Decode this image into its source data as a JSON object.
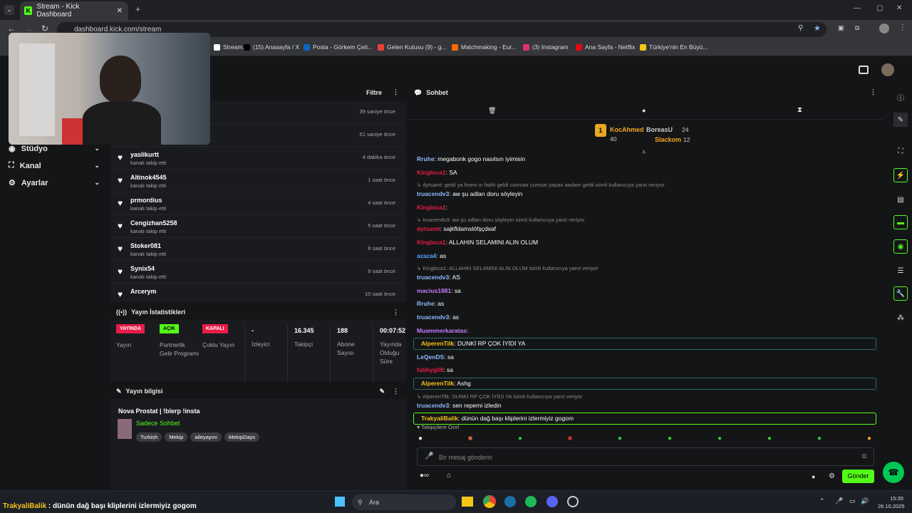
{
  "browser": {
    "tab_title": "Stream - Kick Dashboard",
    "url": "dashboard.kick.com/stream",
    "bookmarks": [
      {
        "label": "Stream...",
        "color": "#ffffff"
      },
      {
        "label": "(15) Anasayfa / X",
        "color": "#000000"
      },
      {
        "label": "Posta - Görkem Çeti...",
        "color": "#0a66c2"
      },
      {
        "label": "Gelen Kutusu (9) - g...",
        "color": "#ea4335"
      },
      {
        "label": "Matchmaking - Eur...",
        "color": "#ff6a00"
      },
      {
        "label": "(3) Instagram",
        "color": "#e1306c"
      },
      {
        "label": "Ana Sayfa - Netflix",
        "color": "#e50914"
      },
      {
        "label": "Türkiye'nin En Büyü...",
        "color": "#f5c518"
      }
    ]
  },
  "sidebar": {
    "items": [
      {
        "label": "Stüdyo",
        "icon": "studio-icon"
      },
      {
        "label": "Kanal",
        "icon": "channel-icon"
      },
      {
        "label": "Ayarlar",
        "icon": "gear-icon"
      }
    ]
  },
  "activity": {
    "filter_label": "Filtre",
    "rows": [
      {
        "name": "",
        "sub": "",
        "time": "39 saniye önce"
      },
      {
        "name": "",
        "sub": "",
        "time": "51 saniye önce"
      },
      {
        "name": "yaslikurtt",
        "sub": "kanalı takip etti",
        "time": "4 dakika önce"
      },
      {
        "name": "Altinok4545",
        "sub": "kanalı takip etti",
        "time": "1 saat önce"
      },
      {
        "name": "prmordius",
        "sub": "kanalı takip etti",
        "time": "4 saat önce"
      },
      {
        "name": "Cengizhan5258",
        "sub": "kanalı takip etti",
        "time": "5 saat önce"
      },
      {
        "name": "Stoker081",
        "sub": "kanalı takip etti",
        "time": "8 saat önce"
      },
      {
        "name": "Synix54",
        "sub": "kanalı takip etti",
        "time": "9 saat önce"
      },
      {
        "name": "Arcerym",
        "sub": "",
        "time": "10 saat önce"
      }
    ]
  },
  "stats": {
    "title": "Yayın İstatistikleri",
    "cols": [
      {
        "badge": "YAYINDA",
        "badge_color": "#e91b47",
        "badge_text_color": "#ffffff",
        "label": "Yayın"
      },
      {
        "badge": "AÇIK",
        "badge_color": "#53fc18",
        "badge_text_color": "#000000",
        "label": "Partnerlik Gelir Programı"
      },
      {
        "badge": "KAPALI",
        "badge_color": "#e91b47",
        "badge_text_color": "#ffffff",
        "label": "Çoklu Yayın"
      },
      {
        "value": "-",
        "label": "İzleyici"
      },
      {
        "value": "16.345",
        "label": "Takipçi"
      },
      {
        "value": "188",
        "label": "Abone Sayısı"
      },
      {
        "value": "00:07:52",
        "label": "Yayında Olduğu Süre"
      }
    ]
  },
  "info": {
    "title": "Yayın bilgisi",
    "stream_title": "Nova Prostat | !blerp !insta",
    "category": "Sadece Sohbet",
    "tags": [
      "Turkish",
      "Mekip",
      "aileyayını",
      "MekipDays"
    ]
  },
  "chat": {
    "title": "Sohbet",
    "leaderboard": {
      "first": {
        "name": "KocAhmed",
        "count": "40",
        "rank": "1"
      },
      "second": {
        "name": "BoreasU",
        "count": "24"
      },
      "third": {
        "name": "Slackom",
        "count": "12"
      }
    },
    "messages": [
      {
        "type": "msg",
        "user": "Rruhe",
        "color": "#8fb8ff",
        "text": ": megabonk gogo nasılsın iyimisin"
      },
      {
        "type": "msg",
        "user": "Kingloca1",
        "color": "#e91b47",
        "text": ": SA"
      },
      {
        "type": "reply",
        "text": "dytsamt: geldi ya fivem in fatihi geldi comsatı cumsat yapan aadam geldi isimli kullanıcıya yanıt veriyor"
      },
      {
        "type": "msg",
        "user": "truacendv3",
        "color": "#8fb8ff",
        "text": ": aw şu adları doru söyleyin"
      },
      {
        "type": "msg",
        "user": "Kingloca1",
        "color": "#e91b47",
        "text": ":"
      },
      {
        "type": "reply",
        "text": "truacendv3: aw şu adları doru söyleyin isimli kullanıcıya yanıt veriyor"
      },
      {
        "type": "msg",
        "user": "dytsamt",
        "color": "#e91b47",
        "text": ": sajkfldamslöfşçdsaf"
      },
      {
        "type": "msg",
        "user": "Kingloca1",
        "color": "#e91b47",
        "text": ": ALLAHIN SELAMINI ALIN OLUM"
      },
      {
        "type": "msg",
        "user": "azaza4",
        "color": "#4fa3ff",
        "text": ": as"
      },
      {
        "type": "reply",
        "text": "Kingloca1: ALLAHIN SELAMINI ALIN OLUM isimli kullanıcıya yanıt veriyor"
      },
      {
        "type": "msg",
        "user": "truacendv3",
        "color": "#8fb8ff",
        "text": ": AS"
      },
      {
        "type": "msg",
        "user": "macius1881",
        "color": "#c77dff",
        "text": ": sa"
      },
      {
        "type": "msg",
        "user": "Rruhe",
        "color": "#8fb8ff",
        "text": ": as"
      },
      {
        "type": "msg",
        "user": "truacendv3",
        "color": "#8fb8ff",
        "text": ": as"
      },
      {
        "type": "msg",
        "user": "Muammerkaratas",
        "color": "#c77dff",
        "text": ":"
      },
      {
        "type": "msg",
        "user": "AlperenTilk",
        "color": "#f5c518",
        "text": ": DUNKİ RP ÇOK İYİDİ YA",
        "hl": true
      },
      {
        "type": "msg",
        "user": "LeQenDS",
        "color": "#8fb8ff",
        "text": ": sa"
      },
      {
        "type": "msg",
        "user": "fatihyg08",
        "color": "#e91b47",
        "text": ": sa"
      },
      {
        "type": "msg",
        "user": "AlperenTilk",
        "color": "#f5c518",
        "text": ": Ashg",
        "hl": true
      },
      {
        "type": "reply",
        "text": "AlperenTilk: DUNKİ RP ÇOK İYİDİ YA isimli kullanıcıya yanıt veriyor"
      },
      {
        "type": "msg",
        "user": "truacendv3",
        "color": "#8fb8ff",
        "text": ": sen repemi izledin"
      },
      {
        "type": "msg",
        "user": "TrakyaliBalik",
        "color": "#f5c518",
        "text": ": dünün dağ başı kliplerini izlermiyiz gogom",
        "hl": true,
        "green": true
      }
    ],
    "followers_only": "Takipçilere Özel",
    "input_placeholder": "Bir mesaj gönderin",
    "send_label": "Gönder"
  },
  "overlay_text": {
    "user": "TrakyaliBalik",
    "text": " : dünün dağ başı kliplerini izlermiyiz gogom"
  },
  "taskbar": {
    "search": "Ara",
    "time": "15:35",
    "date": "26.10.2025"
  }
}
